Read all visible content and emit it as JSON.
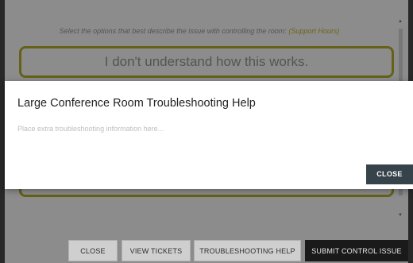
{
  "background": {
    "instructions_text": "Select the options that best describe the issue with controlling the room:",
    "support_hours_link": "(Support Hours)",
    "options": [
      {
        "label": "I don't understand how this works."
      }
    ]
  },
  "footer": {
    "close_label": "CLOSE",
    "view_tickets_label": "VIEW TICKETS",
    "troubleshooting_help_label": "TROUBLESHOOTING HELP",
    "submit_label": "SUBMIT CONTROL ISSUE"
  },
  "modal": {
    "title": "Large Conference Room Troubleshooting Help",
    "body_placeholder": "Place extra troubleshooting information here...",
    "close_label": "CLOSE"
  },
  "colors": {
    "accent_yellow": "#b8b12c",
    "modal_close_bg": "#36434b",
    "primary_button_bg": "#1a1a1a"
  }
}
